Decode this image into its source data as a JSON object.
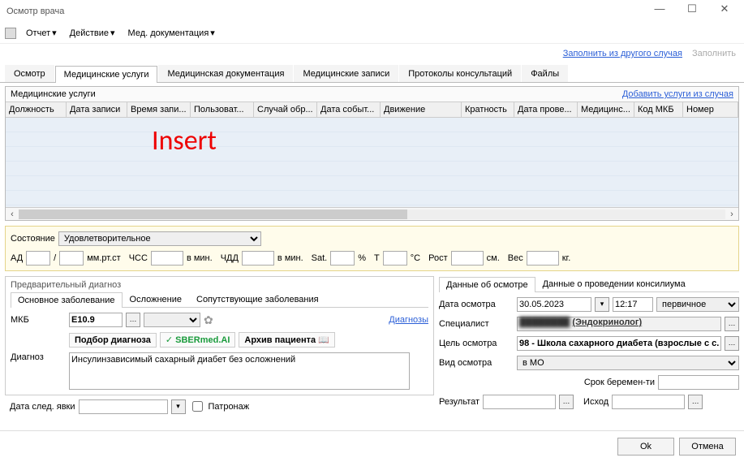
{
  "window": {
    "title": "Осмотр врача"
  },
  "menu": {
    "report": "Отчет",
    "action": "Действие",
    "meddoc": "Мед. документация"
  },
  "top_links": {
    "fill_from_case": "Заполнить из другого случая",
    "fill": "Заполнить"
  },
  "main_tabs": {
    "osmotr": "Осмотр",
    "services": "Медицинские услуги",
    "meddoc": "Медицинская документация",
    "records": "Медицинские записи",
    "protocols": "Протоколы консультаций",
    "files": "Файлы"
  },
  "services": {
    "panel_title": "Медицинские услуги",
    "add_link": "Добавить услуги из случая",
    "columns": [
      "Должность",
      "Дата записи",
      "Время запи...",
      "Пользоват...",
      "Случай обр...",
      "Дата событ...",
      "Движение",
      "Кратность",
      "Дата прове...",
      "Медицинс...",
      "Код МКБ",
      "Номер"
    ],
    "insert_label": "Insert"
  },
  "vitals": {
    "state_label": "Состояние",
    "state_value": "Удовлетворительное",
    "ad_label": "АД",
    "slash": "/",
    "mmrtst": "мм.рт.ст",
    "chss": "ЧСС",
    "vmin1": "в мин.",
    "chdd": "ЧДД",
    "vmin2": "в мин.",
    "sat": "Sat.",
    "pct": "%",
    "t": "Т",
    "degc": "°C",
    "rost": "Рост",
    "cm": "см.",
    "ves": "Вес",
    "kg": "кг."
  },
  "pre_diag": {
    "fieldset_title": "Предварительный диагноз",
    "tabs": {
      "main": "Основное заболевание",
      "compl": "Осложнение",
      "soput": "Сопутствующие заболевания"
    },
    "mkb_label": "МКБ",
    "mkb_value": "E10.9",
    "diagnozy_link": "Диагнозы",
    "podbor": "Подбор диагноза",
    "sbermed": "SBERmed.AI",
    "archive": "Архив пациента",
    "diag_label": "Диагноз",
    "diag_text": "Инсулинзависимый сахарный диабет без осложнений"
  },
  "next_visit": {
    "label": "Дата след. явки",
    "patronazh": "Патронаж"
  },
  "exam": {
    "tabs": {
      "data": "Данные об осмотре",
      "council": "Данные о проведении консилиума"
    },
    "date_label": "Дата осмотра",
    "date_value": "30.05.2023",
    "time_value": "12:17",
    "primary_value": "первичное",
    "spec_label": "Специалист",
    "spec_role": "(Эндокринолог)",
    "goal_label": "Цель осмотра",
    "goal_value": "98 - Школа сахарного диабета (взрослые с с...",
    "view_label": "Вид осмотра",
    "view_value": "в МО",
    "preg_label": "Срок беремен-ти",
    "result_label": "Результат",
    "ishod_label": "Исход"
  },
  "footer": {
    "ok": "Ok",
    "cancel": "Отмена"
  }
}
